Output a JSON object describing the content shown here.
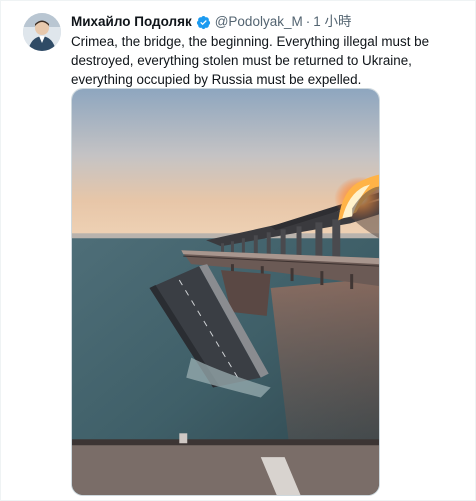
{
  "tweet": {
    "author_name": "Михайло Подоляк",
    "handle": "@Podolyak_M",
    "separator": "·",
    "time": "1 小時",
    "text": "Crimea, the bridge, the beginning. Everything illegal must be destroyed, everything stolen must be returned to Ukraine, everything occupied by Russia must be expelled.",
    "verified": true,
    "avatar_icon": "profile-avatar",
    "verified_icon": "verified-badge-icon"
  },
  "colors": {
    "verified_blue": "#1d9bf0",
    "meta_gray": "#536471",
    "text": "#0f1419"
  }
}
